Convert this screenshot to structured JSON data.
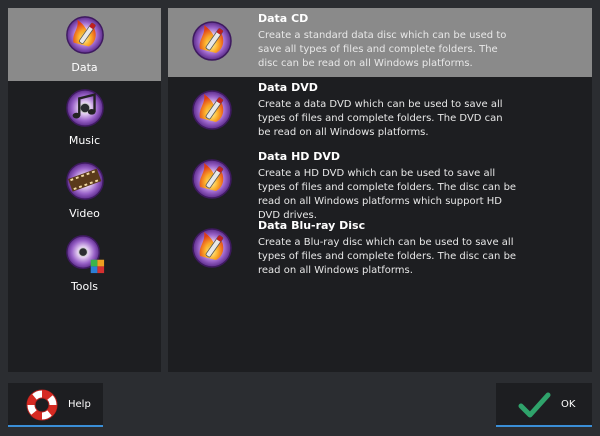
{
  "sidebar": {
    "items": [
      {
        "label": "Data",
        "icon": "data-disc-icon",
        "active": true
      },
      {
        "label": "Music",
        "icon": "music-disc-icon",
        "active": false
      },
      {
        "label": "Video",
        "icon": "video-disc-icon",
        "active": false
      },
      {
        "label": "Tools",
        "icon": "tools-disc-icon",
        "active": false
      }
    ]
  },
  "main": {
    "items": [
      {
        "title": "Data CD",
        "desc": "Create a standard data disc which can be used to save all types of files and complete folders. The disc can be read on all Windows platforms.",
        "active": true
      },
      {
        "title": "Data DVD",
        "desc": "Create a data DVD which can be used to save all types of files and complete folders. The DVD can be read on all Windows platforms.",
        "active": false
      },
      {
        "title": "Data HD DVD",
        "desc": "Create a HD DVD which can be used to save all types of files and complete folders. The disc can be read on all Windows platforms which support HD DVD drives.",
        "active": false
      },
      {
        "title": "Data Blu-ray Disc",
        "desc": "Create a Blu-ray disc which can be used to save all types of files and complete folders. The disc can be read on all Windows platforms.",
        "active": false
      }
    ]
  },
  "footer": {
    "help_label": "Help",
    "ok_label": "OK"
  },
  "colors": {
    "background": "#2b2d31",
    "panel": "#1d1e21",
    "selected": "#8a8a8a",
    "accent": "#3a8ed6",
    "check": "#2fa36b"
  }
}
